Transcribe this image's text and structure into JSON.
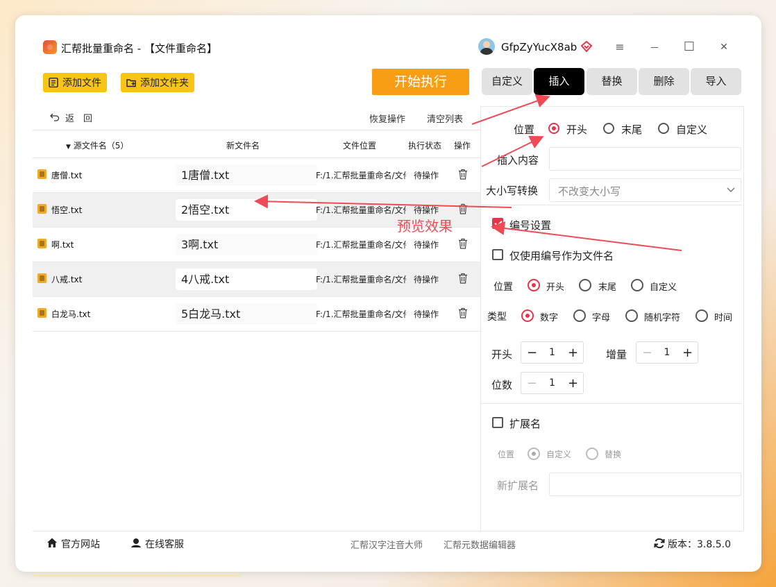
{
  "app": {
    "title": "汇帮批量重命名 - 【文件重命名】",
    "username": "GfpZyYucX8ab"
  },
  "window_controls": {
    "menu": "≡",
    "minimize": "—",
    "maximize": "☐",
    "close": "✕"
  },
  "toolbar": {
    "add_file": "添加文件",
    "add_folder": "添加文件夹",
    "start": "开始执行"
  },
  "tabs": [
    "自定义",
    "插入",
    "替换",
    "删除",
    "导入"
  ],
  "active_tab": "插入",
  "list_actions": {
    "back": "返　回",
    "undo": "恢复操作",
    "clear": "清空列表"
  },
  "columns": {
    "source": "源文件名（5）",
    "new_name": "新文件名",
    "location": "文件位置",
    "status": "执行状态",
    "action": "操作"
  },
  "rows": [
    {
      "source": "唐僧.txt",
      "new_name": "1唐僧.txt",
      "location": "F:/1.汇帮批量重命名/文件",
      "status": "待操作"
    },
    {
      "source": "悟空.txt",
      "new_name": "2悟空.txt",
      "location": "F:/1.汇帮批量重命名/文件",
      "status": "待操作"
    },
    {
      "source": "啊.txt",
      "new_name": "3啊.txt",
      "location": "F:/1.汇帮批量重命名/文件",
      "status": "待操作"
    },
    {
      "source": "八戒.txt",
      "new_name": "4八戒.txt",
      "location": "F:/1.汇帮批量重命名/文件",
      "status": "待操作"
    },
    {
      "source": "白龙马.txt",
      "new_name": "5白龙马.txt",
      "location": "F:/1.汇帮批量重命名/文件",
      "status": "待操作"
    }
  ],
  "panel": {
    "position_label": "位置",
    "position_options": [
      "开头",
      "末尾",
      "自定义"
    ],
    "insert_content_label": "插入内容",
    "insert_content_value": "",
    "case_label": "大小写转换",
    "case_value": "不改变大小写",
    "numbering_label": "编号设置",
    "numbering_checked": true,
    "only_number_label": "仅使用编号作为文件名",
    "only_number_checked": false,
    "num_position_label": "位置",
    "num_position_options": [
      "开头",
      "末尾",
      "自定义"
    ],
    "type_label": "类型",
    "type_options": [
      "数字",
      "字母",
      "随机字符",
      "时间"
    ],
    "start_label": "开头",
    "start_value": "1",
    "increment_label": "增量",
    "increment_value": "1",
    "digits_label": "位数",
    "digits_value": "1",
    "extension_label": "扩展名",
    "extension_checked": false,
    "ext_position_label": "位置",
    "ext_position_options": [
      "自定义",
      "替换"
    ],
    "new_ext_label": "新扩展名",
    "new_ext_value": ""
  },
  "annotation": "预览效果",
  "footer": {
    "website": "官方网站",
    "support": "在线客服",
    "link1": "汇帮汉字注音大师",
    "link2": "汇帮元数据编辑器",
    "version": "版本：3.8.5.0"
  },
  "colors": {
    "accent": "#e8334a",
    "toolbar_button": "#f9c418",
    "start_button": "#f99e14",
    "arrow": "#ef4a55"
  }
}
